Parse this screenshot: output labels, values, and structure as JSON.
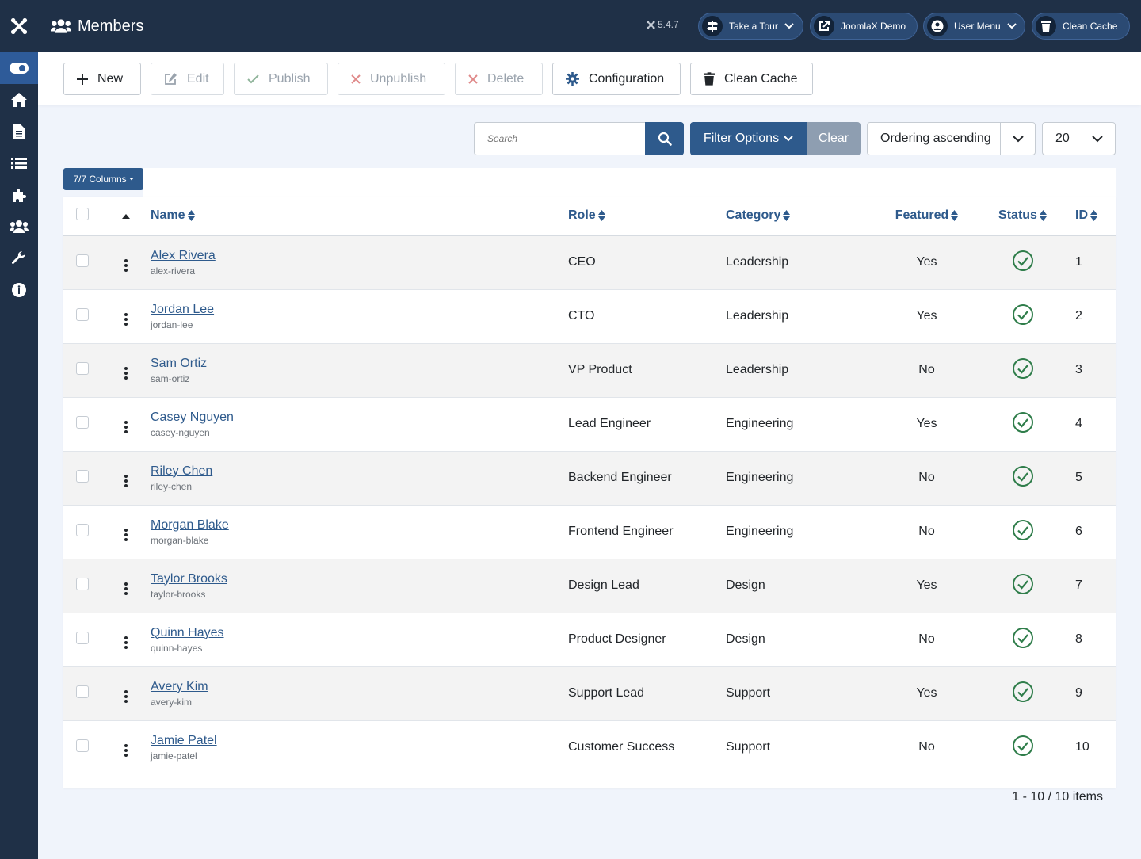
{
  "header": {
    "title": "Members",
    "version": "5.4.7",
    "buttons": [
      {
        "label": "Take a Tour",
        "icon": "signpost-icon",
        "dropdown": true
      },
      {
        "label": "JoomlaX Demo",
        "icon": "external-link-icon",
        "dropdown": false
      },
      {
        "label": "User Menu",
        "icon": "user-circle-icon",
        "dropdown": true
      },
      {
        "label": "Clean Cache",
        "icon": "trash-icon",
        "dropdown": false
      }
    ]
  },
  "sidebar": {
    "items": [
      {
        "icon": "toggle-icon",
        "active": true
      },
      {
        "icon": "home-icon",
        "active": false
      },
      {
        "icon": "file-icon",
        "active": false
      },
      {
        "icon": "list-icon",
        "active": false
      },
      {
        "icon": "puzzle-icon",
        "active": false
      },
      {
        "icon": "users-icon",
        "active": false
      },
      {
        "icon": "wrench-icon",
        "active": false
      },
      {
        "icon": "info-icon",
        "active": false
      }
    ]
  },
  "toolbar": {
    "new": "New",
    "edit": "Edit",
    "publish": "Publish",
    "unpublish": "Unpublish",
    "delete": "Delete",
    "configuration": "Configuration",
    "clean_cache": "Clean Cache"
  },
  "filters": {
    "search_placeholder": "Search",
    "filter_options": "Filter Options",
    "clear": "Clear",
    "ordering": "Ordering ascending",
    "limit": "20",
    "columns": "7/7 Columns"
  },
  "table": {
    "headers": {
      "name": "Name",
      "role": "Role",
      "category": "Category",
      "featured": "Featured",
      "status": "Status",
      "id": "ID"
    },
    "rows": [
      {
        "name": "Alex Rivera",
        "alias": "alex-rivera",
        "role": "CEO",
        "category": "Leadership",
        "featured": "Yes",
        "id": "1"
      },
      {
        "name": "Jordan Lee",
        "alias": "jordan-lee",
        "role": "CTO",
        "category": "Leadership",
        "featured": "Yes",
        "id": "2"
      },
      {
        "name": "Sam Ortiz",
        "alias": "sam-ortiz",
        "role": "VP Product",
        "category": "Leadership",
        "featured": "No",
        "id": "3"
      },
      {
        "name": "Casey Nguyen",
        "alias": "casey-nguyen",
        "role": "Lead Engineer",
        "category": "Engineering",
        "featured": "Yes",
        "id": "4"
      },
      {
        "name": "Riley Chen",
        "alias": "riley-chen",
        "role": "Backend Engineer",
        "category": "Engineering",
        "featured": "No",
        "id": "5"
      },
      {
        "name": "Morgan Blake",
        "alias": "morgan-blake",
        "role": "Frontend Engineer",
        "category": "Engineering",
        "featured": "No",
        "id": "6"
      },
      {
        "name": "Taylor Brooks",
        "alias": "taylor-brooks",
        "role": "Design Lead",
        "category": "Design",
        "featured": "Yes",
        "id": "7"
      },
      {
        "name": "Quinn Hayes",
        "alias": "quinn-hayes",
        "role": "Product Designer",
        "category": "Design",
        "featured": "No",
        "id": "8"
      },
      {
        "name": "Avery Kim",
        "alias": "avery-kim",
        "role": "Support Lead",
        "category": "Support",
        "featured": "Yes",
        "id": "9"
      },
      {
        "name": "Jamie Patel",
        "alias": "jamie-patel",
        "role": "Customer Success",
        "category": "Support",
        "featured": "No",
        "id": "10"
      }
    ]
  },
  "pagination": {
    "info": "1 - 10 / 10 items"
  },
  "colors": {
    "navy": "#1f3047",
    "primary": "#2e5a8c",
    "success": "#2f7d4a",
    "danger": "#c0392b",
    "muted": "#8e9eb1"
  }
}
